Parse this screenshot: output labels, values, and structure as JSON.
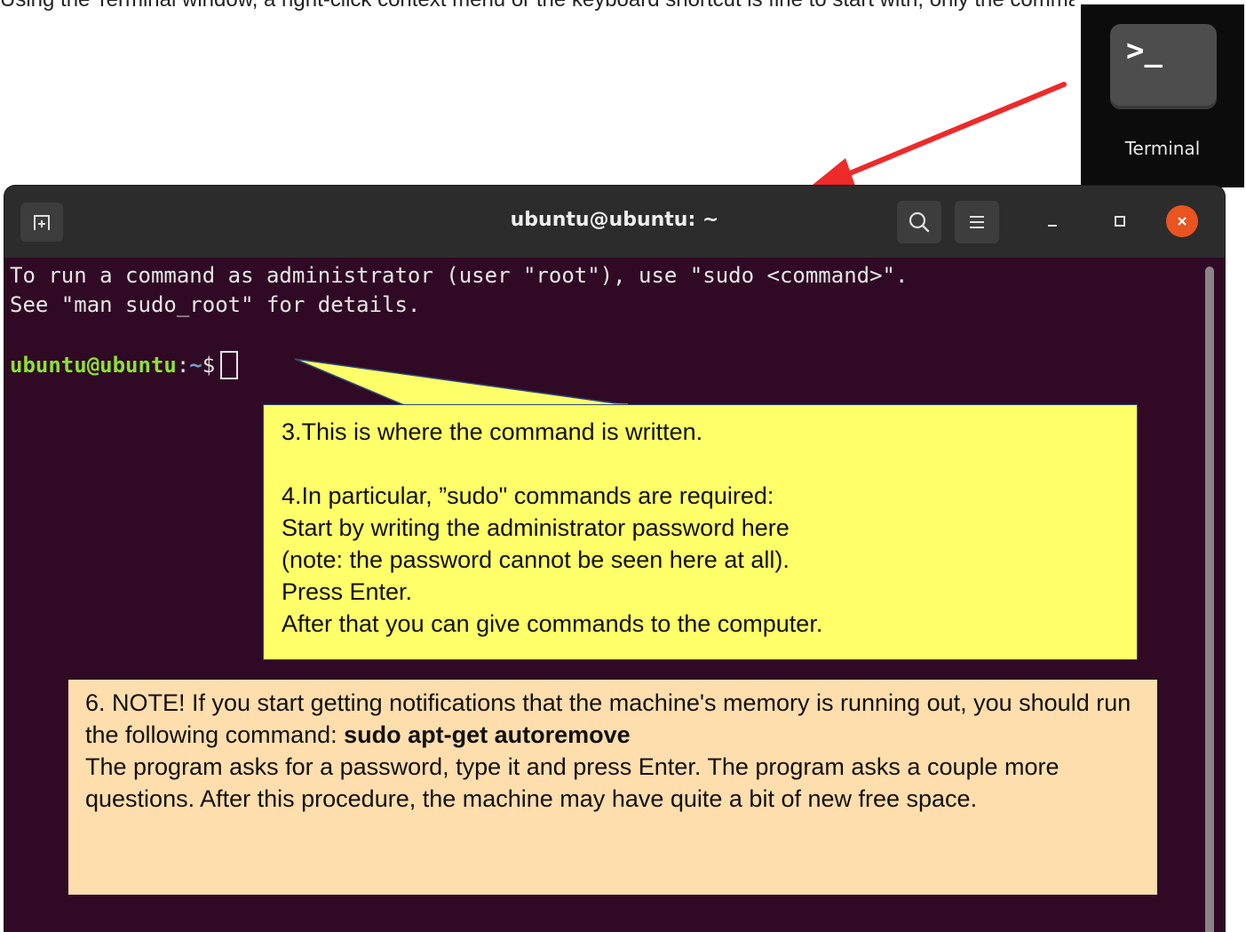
{
  "top_caption": "Using the Terminal window, a right-click context menu or the keyboard shortcut is fine to start with, only the commands matter here.",
  "dock": {
    "app_label": "Terminal",
    "icon_glyph": ">_"
  },
  "window": {
    "title": "ubuntu@ubuntu: ~",
    "buttons": {
      "new_tab_icon": "new-tab-icon",
      "search_icon": "search-icon",
      "menu_icon": "hamburger-menu-icon",
      "minimize_icon": "minimize-icon",
      "maximize_icon": "maximize-icon",
      "close_icon": "close-icon"
    }
  },
  "terminal": {
    "line1": "To run a command as administrator (user \"root\"), use \"sudo <command>\".",
    "line2": "See \"man sudo_root\" for details.",
    "prompt_user": "ubuntu@ubuntu",
    "prompt_sep": ":",
    "prompt_path": "~",
    "prompt_symbol": "$"
  },
  "callout_yellow": {
    "line1": "3.This is where the command is written.",
    "line2": "4.In particular, ”sudo\" commands are required:",
    "line3": "Start by writing the administrator password here",
    "line4": "(note: the password cannot be seen here at all).",
    "line5": "Press Enter.",
    "line6": "After that you can give commands to the computer."
  },
  "callout_peach": {
    "text_before": "6. NOTE! If you start getting notifications that the machine's memory is running out, you should run the following command: ",
    "command": "sudo apt-get autoremove",
    "text_after": "The program asks for a password, type it and press Enter. The program asks a couple more questions. After this procedure, the machine may have quite a bit of new free space."
  },
  "colors": {
    "terminal_bg": "#300a24",
    "titlebar_bg": "#2c2c2c",
    "close_button": "#e95420",
    "prompt_user": "#8ae234",
    "prompt_path": "#729fcf",
    "arrow": "#ee2a2a",
    "callout_yellow": "#ffff6a",
    "callout_peach": "#ffdead"
  }
}
